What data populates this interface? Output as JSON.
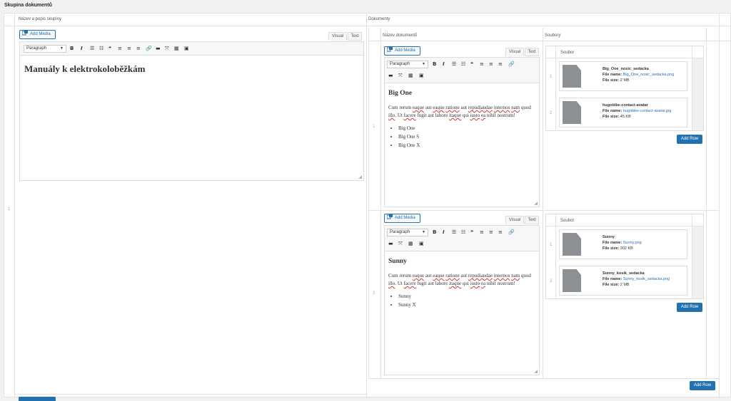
{
  "page": {
    "title": "Skupina dokumentů"
  },
  "outer": {
    "col1_header": "Název a popis skupiny",
    "col2_header": "Dokumenty",
    "row_number": "1",
    "left_editor": {
      "add_media": "Add Media",
      "tab_visual": "Visual",
      "tab_text": "Text",
      "format": "Paragraph",
      "heading": "Manuály k elektrokoloběžkám"
    },
    "add_row": "Add Row"
  },
  "documents": {
    "col_name_header": "Název dokumentů",
    "col_files_header": "Soubory",
    "rows": [
      {
        "num": "1",
        "editor": {
          "add_media": "Add Media",
          "tab_visual": "Visual",
          "tab_text": "Text",
          "format": "Paragraph",
          "title": "Big One",
          "para_words": [
            "Cum rerum ",
            "eaque",
            " aut ",
            "eaque",
            " ",
            "ratione",
            " aut ",
            "repudiandae",
            " ",
            "internos",
            " ",
            "nam",
            " quod ",
            "illo",
            ". Ut ",
            "facere",
            " fugit aut labore ",
            "itaque",
            " qui ",
            "iusto",
            " ",
            "ea",
            " nihil nostrum!"
          ],
          "list": [
            "Big One",
            "Big One S",
            "Big One X"
          ]
        },
        "files": {
          "header": "Soubor",
          "items": [
            {
              "num": "1",
              "name": "Big_One_nosic_sedacka",
              "filename_label": "File name:",
              "filename": "Big_One_nosic_sedacka.png",
              "size_label": "File size:",
              "size": "2 MB"
            },
            {
              "num": "2",
              "name": "hugobike-contact-avatar",
              "filename_label": "File name:",
              "filename": "hugobike-contact-avatar.jpg",
              "size_label": "File size:",
              "size": "45 KB"
            }
          ],
          "add_row": "Add Row"
        }
      },
      {
        "num": "2",
        "editor": {
          "add_media": "Add Media",
          "tab_visual": "Visual",
          "tab_text": "Text",
          "format": "Paragraph",
          "title": "Sunny",
          "para_words": [
            "Cum rerum ",
            "eaque",
            " aut ",
            "eaque",
            " ",
            "ratione",
            " aut ",
            "repudiandae",
            " ",
            "internos",
            " ",
            "nam",
            " quod ",
            "illo",
            ". Ut ",
            "facere",
            " fugit aut labore ",
            "itaque",
            " qui ",
            "iusto",
            " ",
            "ea",
            " nihil nostrum!"
          ],
          "list": [
            "Sunny",
            "Sunny X"
          ]
        },
        "files": {
          "header": "Soubor",
          "items": [
            {
              "num": "1",
              "name": "Sunny",
              "filename_label": "File name:",
              "filename": "Sunny.png",
              "size_label": "File size:",
              "size": "302 KB"
            },
            {
              "num": "2",
              "name": "Sunny_kosik_sedacka",
              "filename_label": "File name:",
              "filename": "Sunny_kosik_sedacka.png",
              "size_label": "File size:",
              "size": "2 MB"
            }
          ],
          "add_row": "Add Row"
        }
      }
    ],
    "add_row": "Add Row"
  },
  "icons": {
    "toolbar": [
      "bold-icon",
      "italic-icon",
      "bullet-list-icon",
      "numbered-list-icon",
      "blockquote-icon",
      "align-left-icon",
      "align-center-icon",
      "align-right-icon",
      "link-icon",
      "read-more-icon",
      "fullscreen-icon",
      "toolbar-toggle-icon",
      "form-icon"
    ]
  },
  "colors": {
    "accent": "#2271b1",
    "border": "#dddddd",
    "background": "#f1f1f1"
  }
}
